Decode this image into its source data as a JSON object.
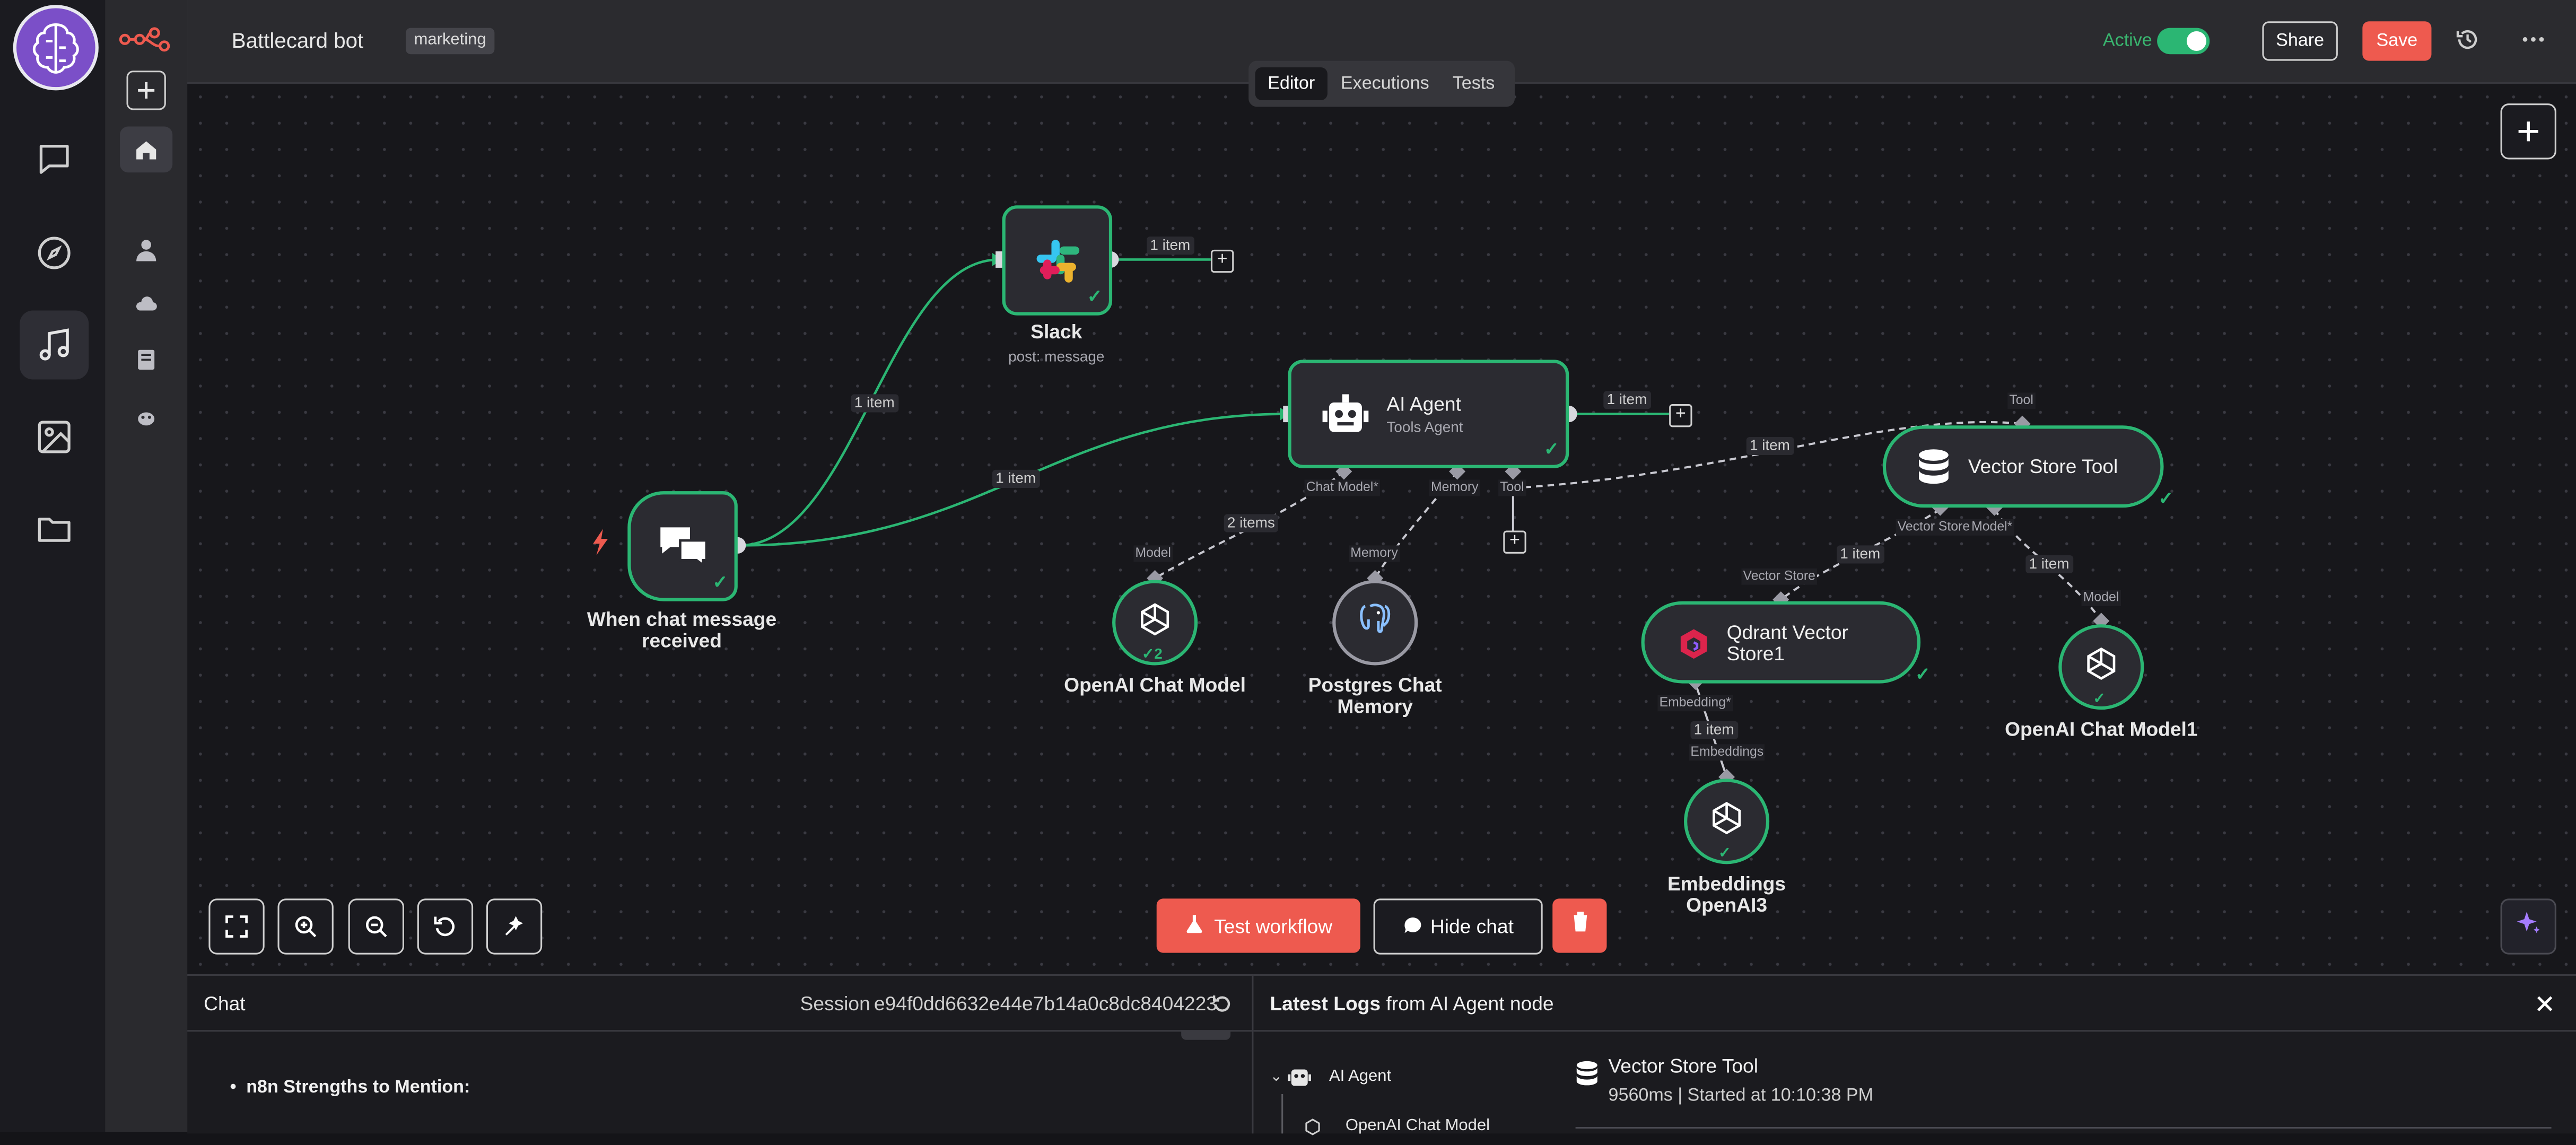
{
  "rail": {
    "icons": [
      "brain-logo-icon",
      "chat-bubble-icon",
      "compass-icon",
      "music-note-icon",
      "image-icon",
      "folder-icon"
    ]
  },
  "sidebar": {
    "icons": [
      "n8n-logo-icon",
      "plus-icon",
      "home-icon",
      "user-icon",
      "cloud-icon",
      "book-icon",
      "badge-icon"
    ]
  },
  "header": {
    "title": "Battlecard bot",
    "tag": "marketing",
    "active_label": "Active",
    "share_label": "Share",
    "save_label": "Save",
    "tabs": [
      {
        "label": "Editor"
      },
      {
        "label": "Executions"
      },
      {
        "label": "Tests"
      }
    ]
  },
  "nodes": {
    "trigger": {
      "label": "When chat message received"
    },
    "slack": {
      "label": "Slack",
      "sub": "post: message"
    },
    "agent": {
      "label": "AI Agent",
      "sub": "Tools Agent",
      "ports": [
        "Chat Model*",
        "Memory",
        "Tool"
      ]
    },
    "openai_model": {
      "label": "OpenAI Chat Model",
      "port": "Model",
      "count": "2"
    },
    "postgres": {
      "label": "Postgres Chat Memory",
      "port": "Memory"
    },
    "vector_tool": {
      "label": "Vector Store Tool",
      "ports_in": [
        "Tool"
      ],
      "ports_out": [
        "Vector Store",
        "Model*"
      ]
    },
    "qdrant": {
      "label": "Qdrant Vector Store1",
      "port_in": "Vector Store",
      "port_out": "Embedding*"
    },
    "openai_model1": {
      "label": "OpenAI Chat Model1",
      "port": "Model"
    },
    "embeddings": {
      "label": "Embeddings OpenAI3",
      "port": "Embeddings"
    }
  },
  "edges": {
    "trigger_slack": "1 item",
    "trigger_agent": "1 item",
    "slack_out": "1 item",
    "agent_out": "1 item",
    "agent_model": "2 items",
    "agent_tool": "1 item",
    "tool_qdrant": "1 item",
    "tool_model1": "1 item",
    "qdrant_embed": "1 item"
  },
  "controls": {
    "test_workflow": "Test workflow",
    "hide_chat": "Hide chat"
  },
  "chat": {
    "title": "Chat",
    "session_label": "Session",
    "session_id": "e94f0dd6632e44e7b14a0c8dc8404223",
    "message_preview": "n8n Strengths to Mention:"
  },
  "logs": {
    "title_bold": "Latest Logs",
    "title_rest": "from AI Agent node",
    "tree": [
      "AI Agent",
      "OpenAI Chat Model"
    ],
    "detail_title": "Vector Store Tool",
    "detail_meta": "9560ms | Started at 10:10:38 PM"
  },
  "colors": {
    "accent": "#ee5a4f",
    "success": "#2bb673",
    "background": "#17171b"
  }
}
